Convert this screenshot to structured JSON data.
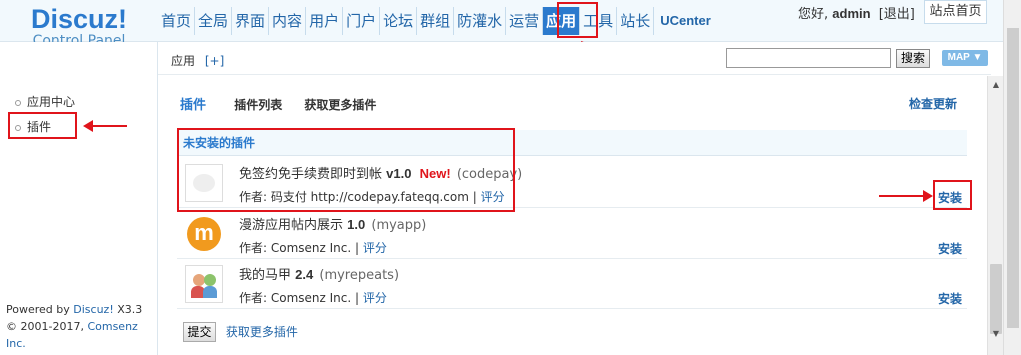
{
  "logo": {
    "brand": "Discuz!",
    "subtitle": "Control Panel"
  },
  "topnav": {
    "items": [
      "首页",
      "全局",
      "界面",
      "内容",
      "用户",
      "门户",
      "论坛",
      "群组",
      "防灌水",
      "运营",
      "应用",
      "工具",
      "站长",
      "UCenter"
    ],
    "active": "应用"
  },
  "user": {
    "greeting": "您好,",
    "name": "admin",
    "logout": "[退出]",
    "site_home": "站点首页"
  },
  "subbar": {
    "crumb": "应用",
    "plus": "[+]",
    "search_button": "搜索",
    "map_button": "MAP"
  },
  "sidebar": {
    "items": [
      "应用中心",
      "插件"
    ],
    "active": "插件"
  },
  "powered": {
    "line1_prefix": "Powered by ",
    "line1_link": "Discuz!",
    "line1_suffix": " X3.3",
    "line2_prefix": "© 2001-2017, ",
    "line2_link": "Comsenz Inc."
  },
  "main": {
    "tabs": [
      "插件",
      "插件列表",
      "获取更多插件"
    ],
    "check_update": "检查更新",
    "section_title": "未安装的插件",
    "plugins": [
      {
        "name": "免签约免手续费即时到帐",
        "version": "v1.0",
        "new_label": "New!",
        "id": "(codepay)",
        "author_label": "作者: 码支付 http://codepay.fateqq.com",
        "rate": "评分",
        "install": "安装"
      },
      {
        "name": "漫游应用帖内展示",
        "version": "1.0",
        "new_label": "",
        "id": "(myapp)",
        "author_label": "作者: Comsenz Inc.",
        "rate": "评分",
        "install": "安装"
      },
      {
        "name": "我的马甲",
        "version": "2.4",
        "new_label": "",
        "id": "(myrepeats)",
        "author_label": "作者: Comsenz Inc.",
        "rate": "评分",
        "install": "安装"
      }
    ],
    "submit": "提交",
    "more_plugins": "获取更多插件"
  },
  "colors": {
    "accent": "#2b7acd",
    "highlight": "#e0141b",
    "link": "#2366a8"
  }
}
